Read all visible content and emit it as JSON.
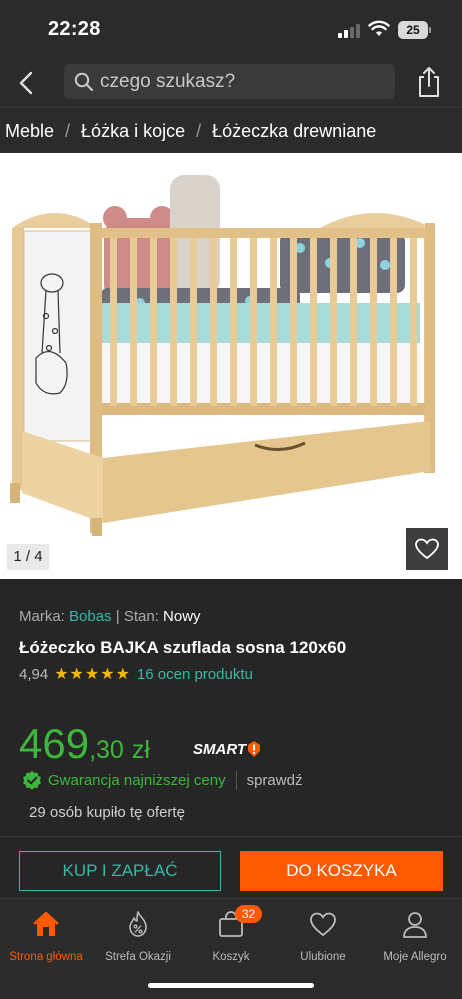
{
  "status_bar": {
    "time": "22:28",
    "battery": "25"
  },
  "search": {
    "placeholder": "czego szukasz?"
  },
  "breadcrumb": {
    "items": [
      "Meble",
      "Łóżka i kojce",
      "Łóżeczka drewniane"
    ]
  },
  "gallery": {
    "counter": "1 / 4"
  },
  "product": {
    "brand_label": "Marka:",
    "brand": "Bobas",
    "separator": "|",
    "condition_label": "Stan:",
    "condition": "Nowy",
    "title": "Łóżeczko BAJKA szuflada sosna 120x60",
    "rating_value": "4,94",
    "stars": "★★★★★",
    "star_count": 5,
    "reviews": "16 ocen produktu",
    "price_int": "469",
    "price_frac": ",30",
    "currency": "zł",
    "smart": "SMART",
    "guarantee": "Gwarancja najniższej ceny",
    "check": "sprawdź",
    "buyers": "29 osób kupiło tę ofertę"
  },
  "actions": {
    "buy_now": "KUP I ZAPŁAĆ",
    "add_to_cart": "DO KOSZYKA"
  },
  "tab_bar": {
    "items": [
      {
        "label": "Strona główna",
        "icon": "home-icon",
        "active": true
      },
      {
        "label": "Strefa Okazji",
        "icon": "deals-icon"
      },
      {
        "label": "Koszyk",
        "icon": "cart-icon",
        "badge": "32"
      },
      {
        "label": "Ulubione",
        "icon": "heart-icon"
      },
      {
        "label": "Moje Allegro",
        "icon": "user-icon"
      }
    ]
  },
  "colors": {
    "accent": "#ff5a00",
    "teal": "#35b9a5",
    "price": "#3cb73c",
    "star": "#f5b800",
    "background": "#222222"
  }
}
